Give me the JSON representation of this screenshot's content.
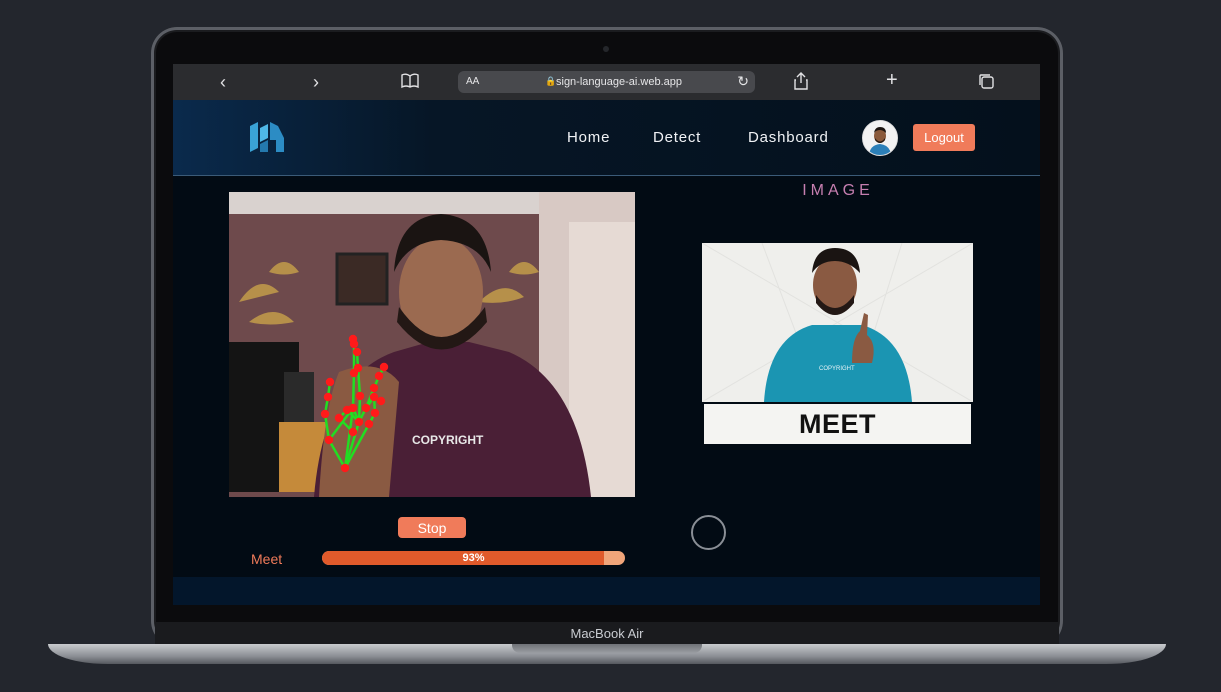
{
  "device_label": "MacBook Air",
  "browser": {
    "url": "sign-language-ai.web.app",
    "text_size_label": "AA"
  },
  "nav": {
    "links": [
      "Home",
      "Detect",
      "Dashboard"
    ],
    "logout_label": "Logout"
  },
  "main": {
    "image_heading": "IMAGE",
    "sign_word": "MEET",
    "stop_label": "Stop",
    "prediction": {
      "label": "Meet",
      "confidence_text": "93%",
      "confidence": 93
    }
  },
  "colors": {
    "accent": "#f07b5a",
    "progress_fill": "#e05a2b",
    "heading": "#c67fb0",
    "landmark_dot": "#ff1a1a",
    "landmark_line": "#22dd22"
  }
}
